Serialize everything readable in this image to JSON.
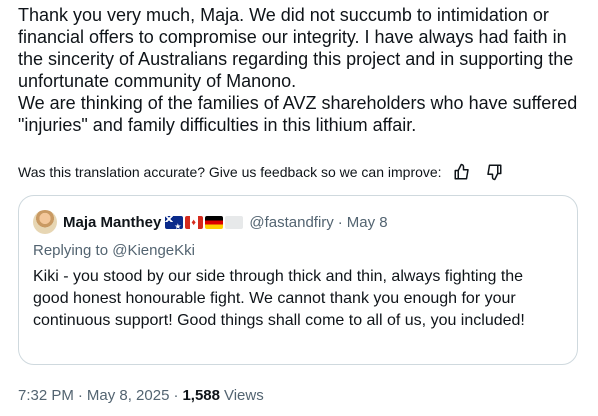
{
  "tweet": {
    "text_p1": "Thank you very much, Maja. We did not succumb to intimidation or financial offers to compromise our integrity. I have always had faith in the sincerity of Australians regarding this project and in supporting the unfortunate community of Manono.",
    "text_p2": "We are thinking of the families of AVZ shareholders who have suffered \"injuries\" and family difficulties in this lithium affair."
  },
  "feedback": {
    "prompt": "Was this translation accurate? Give us feedback so we can improve:",
    "icons": [
      "thumbs-up-icon",
      "thumbs-down-icon"
    ]
  },
  "quote": {
    "name": "Maja Manthey",
    "flags": [
      "flag-australia",
      "flag-canada",
      "flag-germany",
      "flag-blank"
    ],
    "handle": "@fastandfiry",
    "separator": "·",
    "date": "May 8",
    "replying_prefix": "Replying to ",
    "replying_handle": "@KiengeKki",
    "body": "Kiki - you stood by our side through thick and thin, always fighting the good honest honourable fight. We cannot thank you enough for your continuous support! Good things shall come to all of us, you included!"
  },
  "meta": {
    "time": "7:32 PM",
    "separator": "·",
    "date": "May 8, 2025",
    "views_count": "1,588",
    "views_label": "Views"
  }
}
